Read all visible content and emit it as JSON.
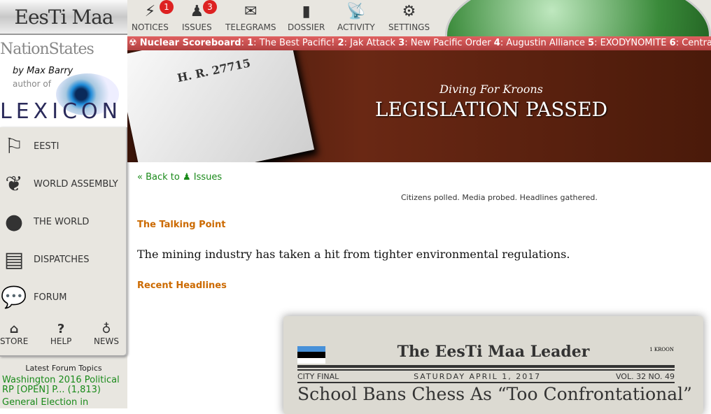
{
  "nation": {
    "name": "EesTi Maa"
  },
  "ad": {
    "site": "NationStates",
    "by": "by Max Barry",
    "author_of": "author of",
    "book": "LEXICON"
  },
  "nav": [
    {
      "label": "EESTI",
      "icon": "flag-icon"
    },
    {
      "label": "WORLD ASSEMBLY",
      "icon": "laurel-icon"
    },
    {
      "label": "THE WORLD",
      "icon": "globe-icon"
    },
    {
      "label": "DISPATCHES",
      "icon": "newspaper-icon"
    },
    {
      "label": "FORUM",
      "icon": "speech-bubbles-icon"
    }
  ],
  "small_nav": [
    {
      "label": "STORE",
      "icon": "gift-icon"
    },
    {
      "label": "HELP",
      "icon": "question-icon"
    },
    {
      "label": "NEWS",
      "icon": "lightbulb-icon"
    }
  ],
  "forum": {
    "heading": "Latest Forum Topics",
    "topics": [
      "Washington 2016 Political RP [OPEN] P... (1,813)",
      "General Election in"
    ]
  },
  "toolbar": [
    {
      "label": "NOTICES",
      "badge": "1"
    },
    {
      "label": "ISSUES",
      "badge": "3"
    },
    {
      "label": "TELEGRAMS"
    },
    {
      "label": "DOSSIER"
    },
    {
      "label": "ACTIVITY"
    },
    {
      "label": "SETTINGS"
    }
  ],
  "ticker": {
    "title": "Nuclear Scoreboard",
    "entries": [
      {
        "rank": "1",
        "name": "The Best Pacific!"
      },
      {
        "rank": "2",
        "name": "Jak Attack"
      },
      {
        "rank": "3",
        "name": "New Pacific Order"
      },
      {
        "rank": "4",
        "name": "Augustin Alliance"
      },
      {
        "rank": "5",
        "name": "EXODYNOMITE"
      },
      {
        "rank": "6",
        "name": "Central Trea"
      }
    ]
  },
  "banner": {
    "subtitle": "Diving For Kroons",
    "title": "LEGISLATION PASSED",
    "paper_text": "H. R. 27715"
  },
  "main": {
    "back": "« Back to",
    "issues": "Issues",
    "polled": "Citizens polled. Media probed. Headlines gathered.",
    "talking_point_heading": "The Talking Point",
    "talking_point": "The mining industry has taken a hit from tighter environmental regulations.",
    "recent_heading": "Recent Headlines"
  },
  "newspaper": {
    "name": "The EesTi Maa Leader",
    "price": "1 KROON",
    "edition": "CITY FINAL",
    "date": "SATURDAY APRIL 1, 2017",
    "volume": "VOL. 32 NO. 49",
    "headline": "School Bans Chess As “Too Confrontational”",
    "flag_colors": [
      "#4891d9",
      "#000000",
      "#ffffff"
    ]
  }
}
